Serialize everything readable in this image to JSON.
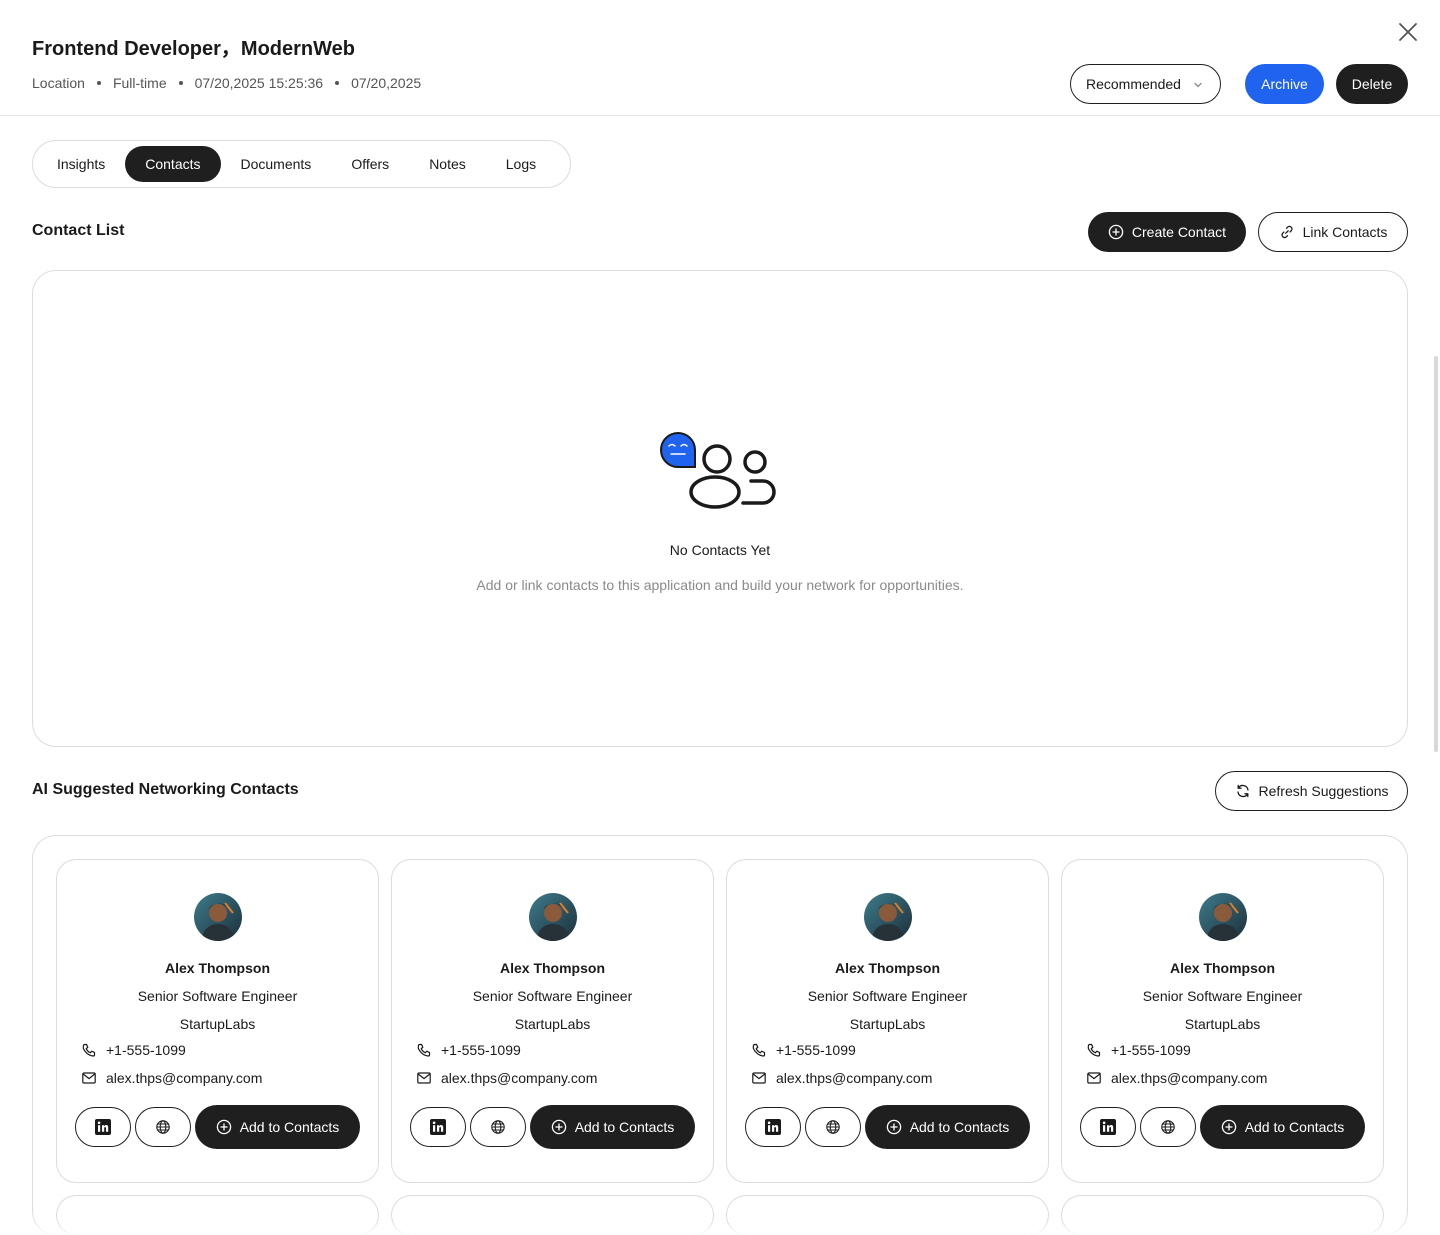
{
  "header": {
    "title": "Frontend Developer，ModernWeb",
    "meta": [
      "Location",
      "Full-time",
      "07/20,2025 15:25:36",
      "07/20,2025"
    ],
    "status_select": "Recommended",
    "archive_label": "Archive",
    "delete_label": "Delete"
  },
  "tabs": [
    {
      "label": "Insights",
      "active": false
    },
    {
      "label": "Contacts",
      "active": true
    },
    {
      "label": "Documents",
      "active": false
    },
    {
      "label": "Offers",
      "active": false
    },
    {
      "label": "Notes",
      "active": false
    },
    {
      "label": "Logs",
      "active": false
    }
  ],
  "contact_list": {
    "title": "Contact List",
    "create_label": "Create Contact",
    "link_label": "Link Contacts",
    "empty_title": "No Contacts Yet",
    "empty_desc": "Add or link contacts to this application and build your network for opportunities."
  },
  "suggestions": {
    "title": "AI Suggested Networking Contacts",
    "refresh_label": "Refresh Suggestions",
    "cards": [
      {
        "name": "Alex Thompson",
        "role": "Senior Software Engineer",
        "company": "StartupLabs",
        "phone": "+1-555-1099",
        "email": "alex.thps@company.com",
        "add_label": "Add to Contacts"
      },
      {
        "name": "Alex Thompson",
        "role": "Senior Software Engineer",
        "company": "StartupLabs",
        "phone": "+1-555-1099",
        "email": "alex.thps@company.com",
        "add_label": "Add to Contacts"
      },
      {
        "name": "Alex Thompson",
        "role": "Senior Software Engineer",
        "company": "StartupLabs",
        "phone": "+1-555-1099",
        "email": "alex.thps@company.com",
        "add_label": "Add to Contacts"
      },
      {
        "name": "Alex Thompson",
        "role": "Senior Software Engineer",
        "company": "StartupLabs",
        "phone": "+1-555-1099",
        "email": "alex.thps@company.com",
        "add_label": "Add to Contacts"
      }
    ]
  },
  "colors": {
    "accent": "#1f63ee",
    "dark": "#1f1f1f",
    "border": "#dcdcdc",
    "muted": "#8a8a8a"
  },
  "icons": [
    "close-icon",
    "chevron-down-icon",
    "plus-circle-icon",
    "link-icon",
    "refresh-icon",
    "phone-icon",
    "mail-icon",
    "linkedin-icon",
    "globe-icon",
    "contacts-empty-icon"
  ]
}
